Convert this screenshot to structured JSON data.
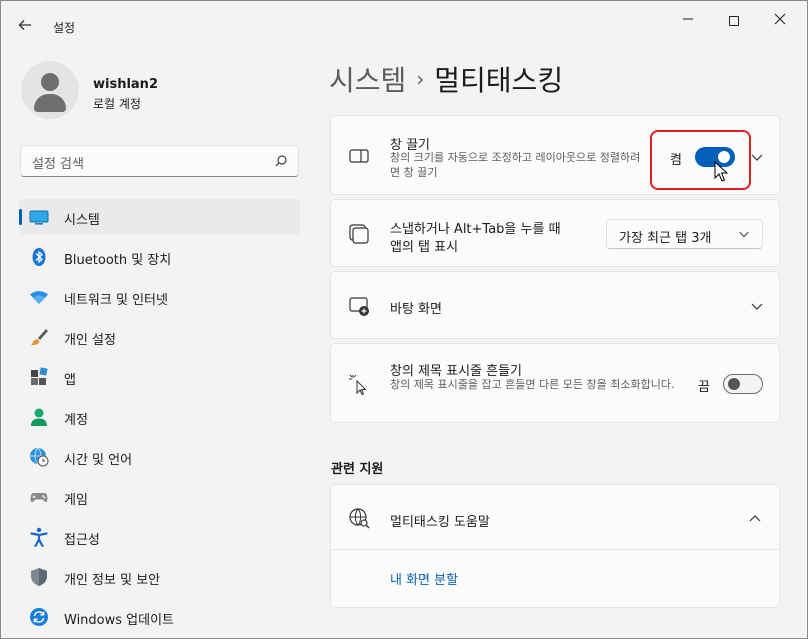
{
  "window": {
    "app_title": "설정",
    "back_icon": "back-arrow-icon",
    "min_glyph": "—",
    "close_glyph": "✕"
  },
  "profile": {
    "name": "wishlan2",
    "account_type": "로컬 계정"
  },
  "search": {
    "placeholder": "설정 검색"
  },
  "sidebar": {
    "items": [
      {
        "label": "시스템",
        "icon": "system-icon",
        "selected": true
      },
      {
        "label": "Bluetooth 및 장치",
        "icon": "bluetooth-icon"
      },
      {
        "label": "네트워크 및 인터넷",
        "icon": "wifi-icon"
      },
      {
        "label": "개인 설정",
        "icon": "brush-icon"
      },
      {
        "label": "앱",
        "icon": "apps-icon"
      },
      {
        "label": "계정",
        "icon": "person-icon"
      },
      {
        "label": "시간 및 언어",
        "icon": "globe-clock-icon"
      },
      {
        "label": "게임",
        "icon": "gamepad-icon"
      },
      {
        "label": "접근성",
        "icon": "accessibility-icon"
      },
      {
        "label": "개인 정보 및 보안",
        "icon": "shield-icon"
      },
      {
        "label": "Windows 업데이트",
        "icon": "update-icon"
      }
    ]
  },
  "breadcrumb": {
    "parent": "시스템",
    "separator": "›",
    "current": "멀티태스킹"
  },
  "settings": {
    "snap": {
      "title": "창 끌기",
      "description": "창의 크기를 자동으로 조정하고 레이아웃으로 정렬하려면 창 끌기",
      "state_label": "켬",
      "on": true
    },
    "alt_tab": {
      "title_line1": "스냅하거나 Alt+Tab을 누를 때",
      "title_line2": "앱의 탭 표시",
      "dropdown_value": "가장 최근 탭 3개"
    },
    "desktops": {
      "title": "바탕 화면"
    },
    "title_bar_shake": {
      "title": "창의 제목 표시줄 흔들기",
      "description": "창의 제목 표시줄을 잡고 흔들면 다른 모든 창을 최소화합니다.",
      "state_label": "끔",
      "on": false
    }
  },
  "related": {
    "section_title": "관련 지원",
    "help_title": "멀티태스킹 도움말",
    "link_label": "내 화면 분할"
  },
  "colors": {
    "accent": "#005fb8",
    "highlight_border": "#e0201a"
  }
}
